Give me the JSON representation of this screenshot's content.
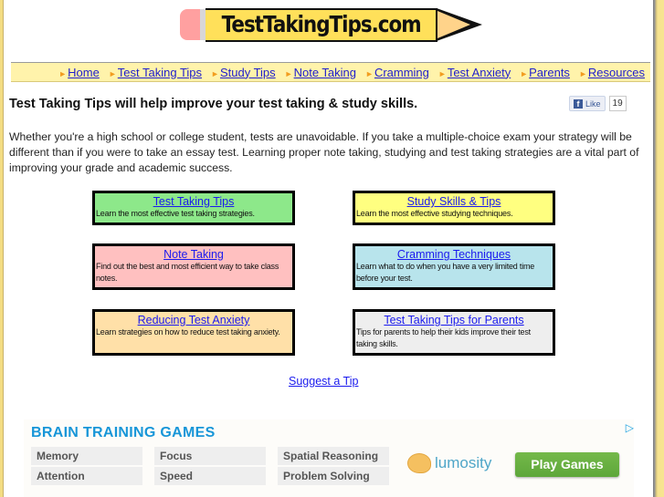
{
  "logo": {
    "text": "TestTakingTips.com"
  },
  "nav": {
    "items": [
      {
        "label": "Home"
      },
      {
        "label": "Test Taking Tips"
      },
      {
        "label": "Study Tips"
      },
      {
        "label": "Note Taking"
      },
      {
        "label": "Cramming"
      },
      {
        "label": "Test Anxiety"
      },
      {
        "label": "Parents"
      },
      {
        "label": "Resources"
      }
    ],
    "arrow": "►"
  },
  "headline": "Test Taking Tips will help improve your test taking & study skills.",
  "facebook": {
    "like_label": "Like",
    "icon": "f",
    "count": "19"
  },
  "intro": "Whether you're a high school or college student, tests are unavoidable. If you take a multiple-choice exam your strategy will be different than if you were to take an essay test. Learning proper note taking, studying and test taking strategies are a vital part of improving your grade and academic success.",
  "boxes": [
    {
      "title": "Test Taking Tips",
      "desc": "Learn the most effective test taking strategies.",
      "color": "#8de88a"
    },
    {
      "title": "Study Skills & Tips",
      "desc": "Learn the most effective studying techniques.",
      "color": "#ffff80"
    },
    {
      "title": "Note Taking",
      "desc": "Find out the best and most efficient way to take class notes.",
      "color": "#ffc0c0"
    },
    {
      "title": "Cramming Techniques",
      "desc": "Learn what to do when you have a very limited time before your test.",
      "color": "#b8e4ec"
    },
    {
      "title": "Reducing Test Anxiety",
      "desc": "Learn strategies on how to reduce test taking anxiety.",
      "color": "#ffe0a8"
    },
    {
      "title": "Test Taking Tips for Parents",
      "desc": "Tips for parents to help their kids improve their test taking skills.",
      "color": "#eeeeee"
    }
  ],
  "suggest_link": "Suggest a Tip",
  "ad": {
    "title": "BRAIN TRAINING GAMES",
    "adchoices_icon": "▷",
    "categories": [
      "Memory",
      "Focus",
      "Spatial Reasoning",
      "Attention",
      "Speed",
      "Problem Solving"
    ],
    "brand": "lumosity",
    "cta": "Play Games"
  }
}
